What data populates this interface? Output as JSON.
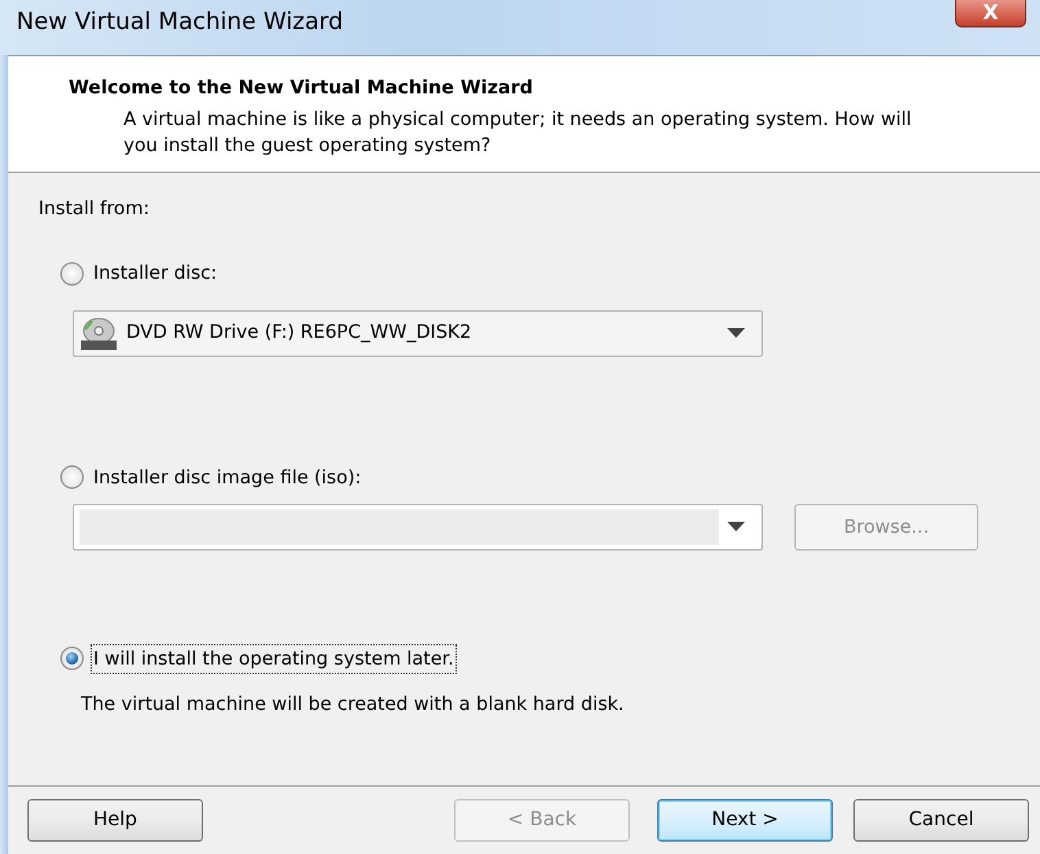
{
  "window": {
    "title": "New Virtual Machine Wizard",
    "close_label": "X"
  },
  "header": {
    "title": "Welcome to the New Virtual Machine Wizard",
    "description": "A virtual machine is like a physical computer; it needs an operating system. How will you install the guest operating system?"
  },
  "install_from_label": "Install from:",
  "options": [
    {
      "kind": "combo",
      "label": "Installer disc:",
      "selected": false,
      "focused": false,
      "combo_value": "DVD RW Drive (F:) RE6PC_WW_DISK2"
    },
    {
      "kind": "file",
      "label": "Installer disc image file (iso):",
      "selected": false,
      "focused": false,
      "browse": {
        "label": "Browse...",
        "disabled": true
      }
    },
    {
      "kind": "note",
      "label": "I will install the operating system later.",
      "selected": true,
      "focused": true,
      "note": "The virtual machine will be created with a blank hard disk."
    }
  ],
  "buttons": [
    {
      "label": "Help",
      "disabled": false,
      "default": false
    },
    {
      "label": "< Back",
      "disabled": true,
      "default": false
    },
    {
      "label": "Next >",
      "disabled": false,
      "default": true
    },
    {
      "label": "Cancel",
      "disabled": false,
      "default": false
    }
  ]
}
